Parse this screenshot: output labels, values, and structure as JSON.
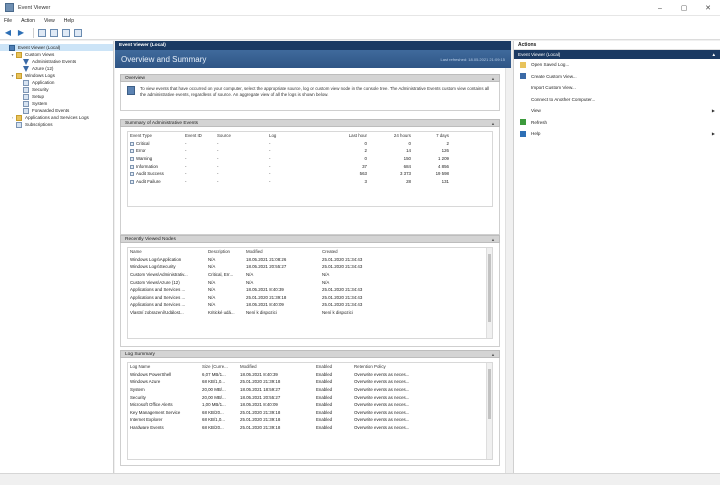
{
  "window": {
    "title": "Event Viewer",
    "controls": [
      "–",
      "▢",
      "✕"
    ]
  },
  "menu": [
    "File",
    "Action",
    "View",
    "Help"
  ],
  "tree": {
    "items": [
      {
        "label": "Event Viewer (Local)",
        "level": 0,
        "icon": "computer-icon",
        "selected": true
      },
      {
        "label": "Custom Views",
        "level": 1,
        "icon": "folder-icon",
        "expander": "▾"
      },
      {
        "label": "Administrative Events",
        "level": 2,
        "icon": "filter-icon"
      },
      {
        "label": "Azure (12)",
        "level": 2,
        "icon": "filter-icon"
      },
      {
        "label": "Windows Logs",
        "level": 1,
        "icon": "folder-icon",
        "expander": "▾"
      },
      {
        "label": "Application",
        "level": 2,
        "icon": "log-icon"
      },
      {
        "label": "Security",
        "level": 2,
        "icon": "log-icon"
      },
      {
        "label": "Setup",
        "level": 2,
        "icon": "log-icon"
      },
      {
        "label": "System",
        "level": 2,
        "icon": "log-icon"
      },
      {
        "label": "Forwarded Events",
        "level": 2,
        "icon": "log-icon"
      },
      {
        "label": "Applications and Services Logs",
        "level": 1,
        "icon": "folder-icon",
        "expander": "›"
      },
      {
        "label": "Subscriptions",
        "level": 1,
        "icon": "log-icon"
      }
    ]
  },
  "center": {
    "pane_title": "Event Viewer (Local)",
    "banner_title": "Overview and Summary",
    "last_refreshed": "Last refreshed: 18.05.2021 21:09:15",
    "overview": {
      "title": "Overview",
      "text": "To view events that have occurred on your computer, select the appropriate source, log or custom view node in the console tree. The Administrative Events custom view contains all the administrative events, regardless of source. An aggregate view of all the logs is shown below."
    },
    "summary": {
      "title": "Summary of Administrative Events",
      "columns": [
        "Event Type",
        "Event ID",
        "Source",
        "Log",
        "Last hour",
        "24 hours",
        "7 days"
      ],
      "rows": [
        [
          "Critical",
          "-",
          "-",
          "-",
          "0",
          "0",
          "2"
        ],
        [
          "Error",
          "-",
          "-",
          "-",
          "2",
          "14",
          "126"
        ],
        [
          "Warning",
          "-",
          "-",
          "-",
          "0",
          "150",
          "1 209"
        ],
        [
          "Information",
          "-",
          "-",
          "-",
          "37",
          "684",
          "4 856"
        ],
        [
          "Audit Success",
          "-",
          "-",
          "-",
          "563",
          "3 373",
          "19 598"
        ],
        [
          "Audit Failure",
          "-",
          "-",
          "-",
          "3",
          "28",
          "131"
        ]
      ]
    },
    "recent": {
      "title": "Recently Viewed Nodes",
      "columns": [
        "Name",
        "Description",
        "Modified",
        "Created"
      ],
      "rows": [
        [
          "Windows Logs\\Application",
          "N/A",
          "18.05.2021 21:08:26",
          "25.01.2020 21:34:43"
        ],
        [
          "Windows Logs\\Security",
          "N/A",
          "18.05.2021 20:55:27",
          "25.01.2020 21:34:43"
        ],
        [
          "Custom Views\\Administrativ...",
          "Critical, Err...",
          "N/A",
          "N/A"
        ],
        [
          "Custom Views\\Azure (12)",
          "N/A",
          "N/A",
          "N/A"
        ],
        [
          "Applications and Services ...",
          "N/A",
          "18.05.2021 8:40:39",
          "25.01.2020 21:34:43"
        ],
        [
          "Applications and Services ...",
          "N/A",
          "25.01.2020 21:39:18",
          "25.01.2020 21:34:43"
        ],
        [
          "Applications and Services ...",
          "N/A",
          "18.05.2021 8:40:09",
          "25.01.2020 21:34:43"
        ],
        [
          "Vlastní zobrazení\\Událost...",
          "Kritické udá...",
          "Není k dispozici",
          "Není k dispozici"
        ]
      ]
    },
    "logsummary": {
      "title": "Log Summary",
      "columns": [
        "Log Name",
        "Size (Curre...",
        "Modified",
        "Enabled",
        "Retention Policy"
      ],
      "rows": [
        [
          "Windows PowerShell",
          "6,07 MB/1...",
          "18.05.2021 8:40:39",
          "Enabled",
          "Overwrite events as neces..."
        ],
        [
          "Windows Azure",
          "68 KB/1,0...",
          "25.01.2020 21:39:18",
          "Enabled",
          "Overwrite events as neces..."
        ],
        [
          "System",
          "20,00 MB/...",
          "18.05.2021 18:59:27",
          "Enabled",
          "Overwrite events as neces..."
        ],
        [
          "Security",
          "20,00 MB/...",
          "18.05.2021 20:55:27",
          "Enabled",
          "Overwrite events as neces..."
        ],
        [
          "Microsoft Office Alerts",
          "1,00 MB/1...",
          "18.05.2021 8:40:09",
          "Enabled",
          "Overwrite events as neces..."
        ],
        [
          "Key Management Service",
          "68 KB/20...",
          "25.01.2020 21:39:18",
          "Enabled",
          "Overwrite events as neces..."
        ],
        [
          "Internet Explorer",
          "68 KB/1,0...",
          "25.01.2020 21:39:18",
          "Enabled",
          "Overwrite events as neces..."
        ],
        [
          "Hardware Events",
          "68 KB/20...",
          "25.01.2020 21:39:18",
          "Enabled",
          "Overwrite events as neces..."
        ]
      ]
    }
  },
  "actions": {
    "title": "Actions",
    "subheader": "Event Viewer (Local)",
    "items": [
      {
        "label": "Open Saved Log...",
        "icon": "open-folder-icon"
      },
      {
        "label": "Create Custom View...",
        "icon": "filter-icon"
      },
      {
        "label": "Import Custom View...",
        "icon": ""
      },
      {
        "label": "Connect to Another Computer...",
        "icon": ""
      },
      {
        "label": "View",
        "icon": "",
        "more": "▶"
      },
      {
        "label": "Refresh",
        "icon": "refresh-icon"
      },
      {
        "label": "Help",
        "icon": "help-icon",
        "more": "▶"
      }
    ]
  },
  "colors": {
    "header_navy": "#1b3a63",
    "banner_blue": "#2f5585",
    "selection": "#cce4f7"
  }
}
